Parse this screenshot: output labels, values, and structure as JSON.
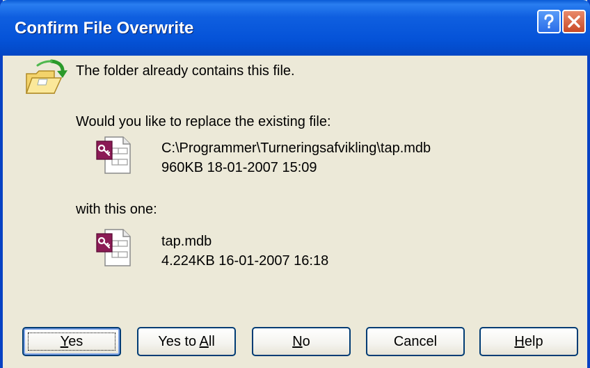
{
  "window": {
    "title": "Confirm File Overwrite"
  },
  "titlebar_buttons": {
    "help_icon": "question-mark",
    "close_icon": "x-mark"
  },
  "message": {
    "header": "The folder already contains this file.",
    "question": "Would you like to replace the existing file:",
    "with_label": "with this one:"
  },
  "existing_file": {
    "path": "C:\\Programmer\\Turneringsafvikling\\tap.mdb",
    "details": "960KB  18-01-2007  15:09",
    "icon": "access-database-icon"
  },
  "new_file": {
    "name": "tap.mdb",
    "details": "4.224KB  16-01-2007  16:18",
    "icon": "access-database-icon"
  },
  "buttons": {
    "yes": {
      "prefix": "",
      "accel": "Y",
      "suffix": "es"
    },
    "yes_to_all": {
      "prefix": "Yes to ",
      "accel": "A",
      "suffix": "ll"
    },
    "no": {
      "prefix": "",
      "accel": "N",
      "suffix": "o"
    },
    "cancel": {
      "prefix": "Cancel",
      "accel": "",
      "suffix": ""
    },
    "help": {
      "prefix": "",
      "accel": "H",
      "suffix": "elp"
    }
  },
  "colors": {
    "titlebar": "#0553d8",
    "dialog_bg": "#ece9d8",
    "button_border": "#003c74",
    "access_icon": "#8b1a55"
  }
}
